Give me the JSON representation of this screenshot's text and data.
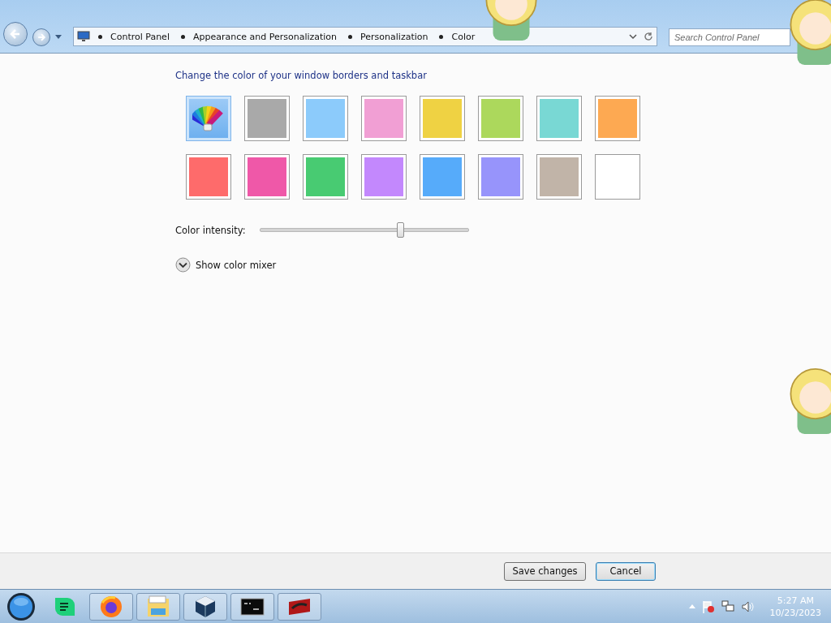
{
  "address_bar": {
    "breadcrumb": [
      "Control Panel",
      "Appearance and Personalization",
      "Personalization",
      "Color"
    ]
  },
  "search": {
    "placeholder": "Search Control Panel"
  },
  "heading": "Change the color of your window borders and taskbar",
  "swatches": [
    {
      "kind": "picker",
      "selected": true
    },
    {
      "kind": "color",
      "color": "#a9a9a9",
      "selected": false
    },
    {
      "kind": "color",
      "color": "#8ccbfb",
      "selected": false
    },
    {
      "kind": "color",
      "color": "#f19fd4",
      "selected": false
    },
    {
      "kind": "color",
      "color": "#efd243",
      "selected": false
    },
    {
      "kind": "color",
      "color": "#acd85c",
      "selected": false
    },
    {
      "kind": "color",
      "color": "#79d8d4",
      "selected": false
    },
    {
      "kind": "color",
      "color": "#fda952",
      "selected": false
    },
    {
      "kind": "color",
      "color": "#fe6b6b",
      "selected": false
    },
    {
      "kind": "color",
      "color": "#ef58a8",
      "selected": false
    },
    {
      "kind": "color",
      "color": "#48cb72",
      "selected": false
    },
    {
      "kind": "color",
      "color": "#c388fd",
      "selected": false
    },
    {
      "kind": "color",
      "color": "#56abfa",
      "selected": false
    },
    {
      "kind": "color",
      "color": "#9794fb",
      "selected": false
    },
    {
      "kind": "color",
      "color": "#c1b4a8",
      "selected": false
    },
    {
      "kind": "color",
      "color": "#ffffff",
      "selected": false
    }
  ],
  "intensity": {
    "label": "Color intensity:",
    "level": 0.67
  },
  "mixer": {
    "label": "Show color mixer",
    "expanded": false
  },
  "buttons": [
    {
      "label": "Save changes",
      "focused": false
    },
    {
      "label": "Cancel",
      "focused": true
    }
  ],
  "taskbar": {
    "time": "5:27 AM",
    "date": "10/23/2023"
  }
}
